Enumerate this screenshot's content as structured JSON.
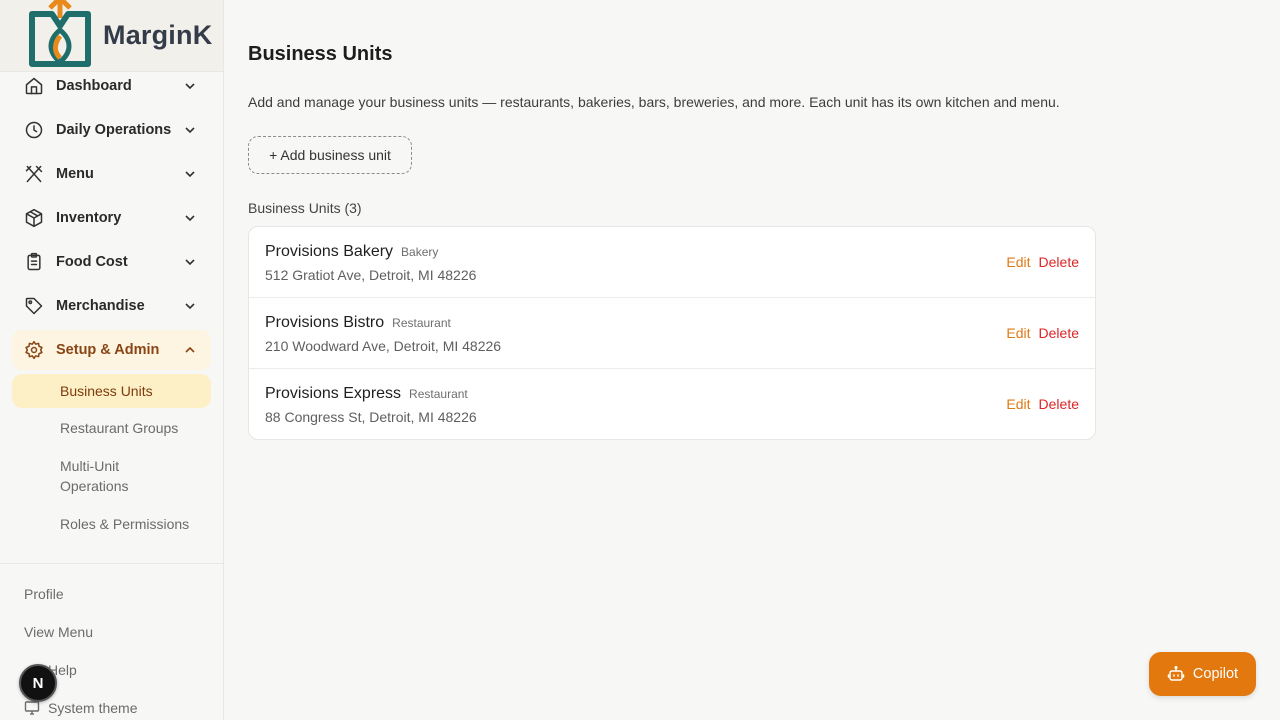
{
  "brand": {
    "name": "MarginK",
    "colors": {
      "orange": "#e88a1c",
      "teal": "#1f6e6b",
      "accent": "#e3780f",
      "danger": "#dc2626"
    }
  },
  "sidebar": {
    "nav": [
      {
        "label": "Dashboard",
        "icon": "home-icon",
        "expanded": false
      },
      {
        "label": "Daily Operations",
        "icon": "clock-icon",
        "expanded": false
      },
      {
        "label": "Menu",
        "icon": "utensils-icon",
        "expanded": false
      },
      {
        "label": "Inventory",
        "icon": "box-icon",
        "expanded": false
      },
      {
        "label": "Food Cost",
        "icon": "clipboard-icon",
        "expanded": false
      },
      {
        "label": "Merchandise",
        "icon": "tag-icon",
        "expanded": false
      },
      {
        "label": "Setup & Admin",
        "icon": "gear-icon",
        "expanded": true
      }
    ],
    "subnav": [
      {
        "label": "Business Units",
        "active": true
      },
      {
        "label": "Restaurant Groups",
        "active": false
      },
      {
        "label": "Multi-Unit Operations",
        "active": false
      },
      {
        "label": "Roles & Permissions",
        "active": false
      }
    ],
    "footer": {
      "profile": "Profile",
      "view_menu": "View Menu",
      "help": "Help",
      "theme": "System theme"
    },
    "avatar_letter": "N"
  },
  "main": {
    "title": "Business Units",
    "description": "Add and manage your business units — restaurants, bakeries, bars, breweries, and more. Each unit has its own kitchen and menu.",
    "add_button": "+ Add business unit",
    "list_heading": "Business Units (3)",
    "units": [
      {
        "name": "Provisions Bakery",
        "type": "Bakery",
        "address": "512 Gratiot Ave, Detroit, MI 48226"
      },
      {
        "name": "Provisions Bistro",
        "type": "Restaurant",
        "address": "210 Woodward Ave, Detroit, MI 48226"
      },
      {
        "name": "Provisions Express",
        "type": "Restaurant",
        "address": "88 Congress St, Detroit, MI 48226"
      }
    ],
    "edit_label": "Edit",
    "delete_label": "Delete"
  },
  "copilot": {
    "label": "Copilot",
    "icon": "bot-icon"
  }
}
